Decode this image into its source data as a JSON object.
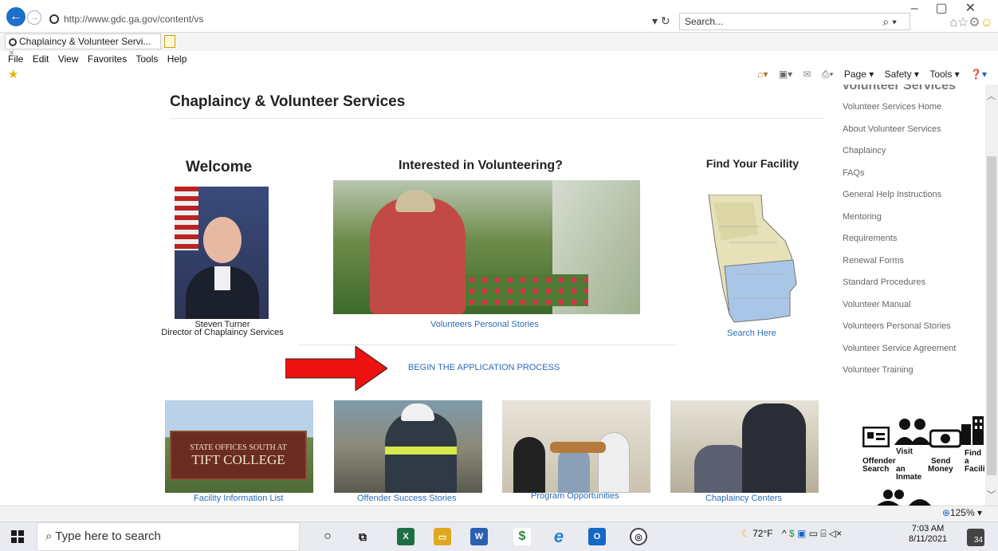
{
  "browser": {
    "url": "http://www.gdc.ga.gov/content/vs",
    "search_placeholder": "Search...",
    "tab_title": "Chaplaincy & Volunteer Servi...",
    "menu": [
      "File",
      "Edit",
      "View",
      "Favorites",
      "Tools",
      "Help"
    ],
    "cmd_page": "Page ▾",
    "cmd_safety": "Safety ▾",
    "cmd_tools": "Tools ▾",
    "zoom": "125%"
  },
  "page": {
    "title": "Chaplaincy & Volunteer Services",
    "sidebar_heading_cut": "Volunteer Services",
    "welcome": "Welcome",
    "director_name": "Steven Turner",
    "director_role": "Director of Chaplaincy Services",
    "interested": "Interested in Volunteering?",
    "vol_stories_link": "Volunteers Personal Stories",
    "begin_link": "BEGIN THE APPLICATION PROCESS",
    "find_facility": "Find Your Facility",
    "search_here": "Search Here",
    "sign_line1": "STATE OFFICES SOUTH AT",
    "sign_line2": "TIFT COLLEGE",
    "captions": [
      "Facility Information List",
      "Offender Success Stories",
      "Program Opportunities",
      "Chaplaincy Centers"
    ],
    "quicklinks": {
      "offender_search": "Offender Search",
      "visit_inmate_1": "Visit",
      "visit_inmate_2": "an Inmate",
      "send_money_1": "Send",
      "send_money_2": "Money",
      "find_facility_1": "Find",
      "find_facility_2": "a",
      "find_facility_3": "Facility"
    }
  },
  "sidebar": [
    "Volunteer Services Home",
    "About Volunteer Services",
    "Chaplaincy",
    "FAQs",
    "General Help Instructions",
    "Mentoring",
    "Requirements",
    "Renewal Forms",
    "Standard Procedures",
    "Volunteer Manual",
    "Volunteers Personal Stories",
    "Volunteer Service Agreement",
    "Volunteer Training"
  ],
  "taskbar": {
    "search_placeholder": "Type here to search",
    "weather": "72°F",
    "time": "7:03 AM",
    "date": "8/11/2021",
    "notifications": "34"
  },
  "colors": {
    "link": "#2b6cb8",
    "arrow": "#ee1111",
    "sidebar_text": "#666666"
  }
}
